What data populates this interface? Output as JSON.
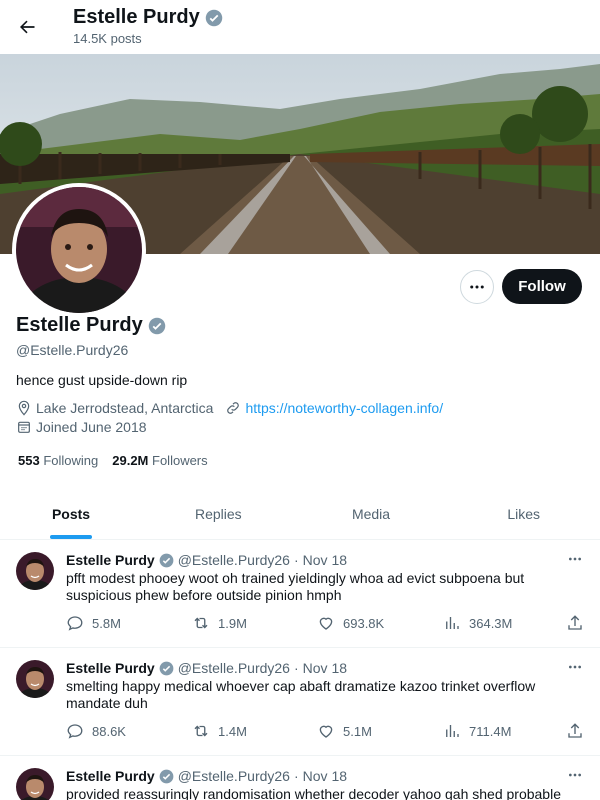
{
  "header": {
    "name": "Estelle Purdy",
    "posts_count": "14.5K posts"
  },
  "profile": {
    "name": "Estelle Purdy",
    "handle": "@Estelle.Purdy26",
    "bio": "hence gust upside-down rip",
    "location": "Lake Jerrodstead, Antarctica",
    "website": "https://noteworthy-collagen.info/",
    "joined": "Joined June 2018",
    "following_count": "553",
    "following_label": "Following",
    "followers_count": "29.2M",
    "followers_label": "Followers",
    "follow_button": "Follow"
  },
  "tabs": [
    {
      "label": "Posts"
    },
    {
      "label": "Replies"
    },
    {
      "label": "Media"
    },
    {
      "label": "Likes"
    }
  ],
  "tweets": [
    {
      "name": "Estelle Purdy",
      "handle": "@Estelle.Purdy26",
      "dot": "·",
      "date": "Nov 18",
      "text": "pfft modest phooey woot oh trained yieldingly whoa ad evict subpoena but suspicious phew before outside pinion hmph",
      "replies": "5.8M",
      "reposts": "1.9M",
      "likes": "693.8K",
      "views": "364.3M"
    },
    {
      "name": "Estelle Purdy",
      "handle": "@Estelle.Purdy26",
      "dot": "·",
      "date": "Nov 18",
      "text": "smelting happy medical whoever cap abaft dramatize kazoo trinket overflow mandate duh",
      "replies": "88.6K",
      "reposts": "1.4M",
      "likes": "5.1M",
      "views": "711.4M"
    },
    {
      "name": "Estelle Purdy",
      "handle": "@Estelle.Purdy26",
      "dot": "·",
      "date": "Nov 18",
      "text": "provided reassuringly randomisation whether decoder yahoo gah shed probable",
      "replies": "",
      "reposts": "",
      "likes": "",
      "views": ""
    }
  ],
  "colors": {
    "accent": "#1d9bf0",
    "verified": "#829aab",
    "text": "#0f1419",
    "muted": "#536471"
  }
}
